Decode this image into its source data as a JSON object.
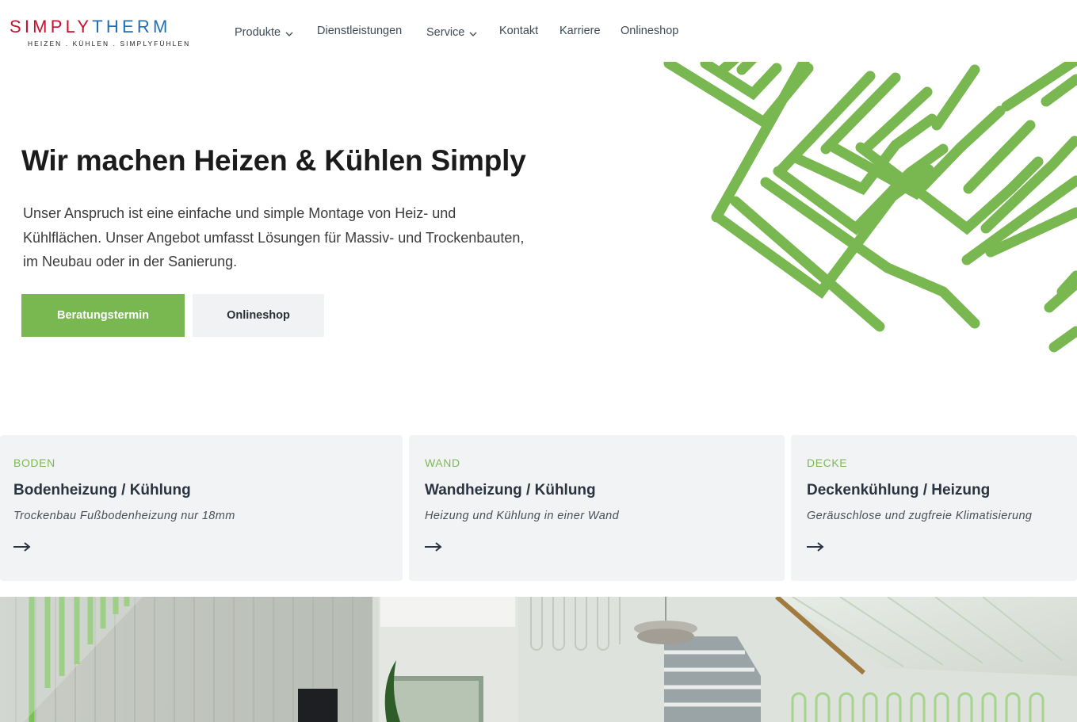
{
  "brand": {
    "logo_part1": "SIMPLY",
    "logo_part2": "THERM",
    "tagline": "HEIZEN . KÜHLEN . SIMPLYFÜHLEN",
    "color_red": "#c8102e",
    "color_blue": "#1f6fb6"
  },
  "nav": {
    "items": [
      {
        "label": "Produkte",
        "dropdown": true
      },
      {
        "label": "Dienstleistungen",
        "dropdown": false
      },
      {
        "label": "Service",
        "dropdown": true
      },
      {
        "label": "Kontakt",
        "dropdown": false
      },
      {
        "label": "Karriere",
        "dropdown": false
      },
      {
        "label": "Onlineshop",
        "dropdown": false
      }
    ]
  },
  "hero": {
    "title": "Wir machen Heizen & Kühlen Simply",
    "text": "Unser Anspruch ist eine einfache und simple Montage von Heiz- und Kühlflächen. Unser Angebot umfasst Lösungen für Massiv- und Trockenbauten, im Neubau oder in der Sanierung.",
    "primary_button": "Beratungstermin",
    "secondary_button": "Onlineshop",
    "accent_color": "#79b751"
  },
  "cards": [
    {
      "kicker": "BODEN",
      "title": "Bodenheizung / Kühlung",
      "subtitle": "Trockenbau Fußbodenheizung nur 18mm",
      "icon": "arrow-right-icon"
    },
    {
      "kicker": "WAND",
      "title": "Wandheizung / Kühlung",
      "subtitle": "Heizung und Kühlung in einer Wand",
      "icon": "arrow-right-icon"
    },
    {
      "kicker": "DECKE",
      "title": "Deckenkühlung / Heizung",
      "subtitle": "Geräuschlose und zugfreie Klimatisierung",
      "icon": "arrow-right-icon"
    }
  ],
  "colors": {
    "kicker_green": "#7cb95a",
    "card_bg": "#f2f3f4"
  }
}
